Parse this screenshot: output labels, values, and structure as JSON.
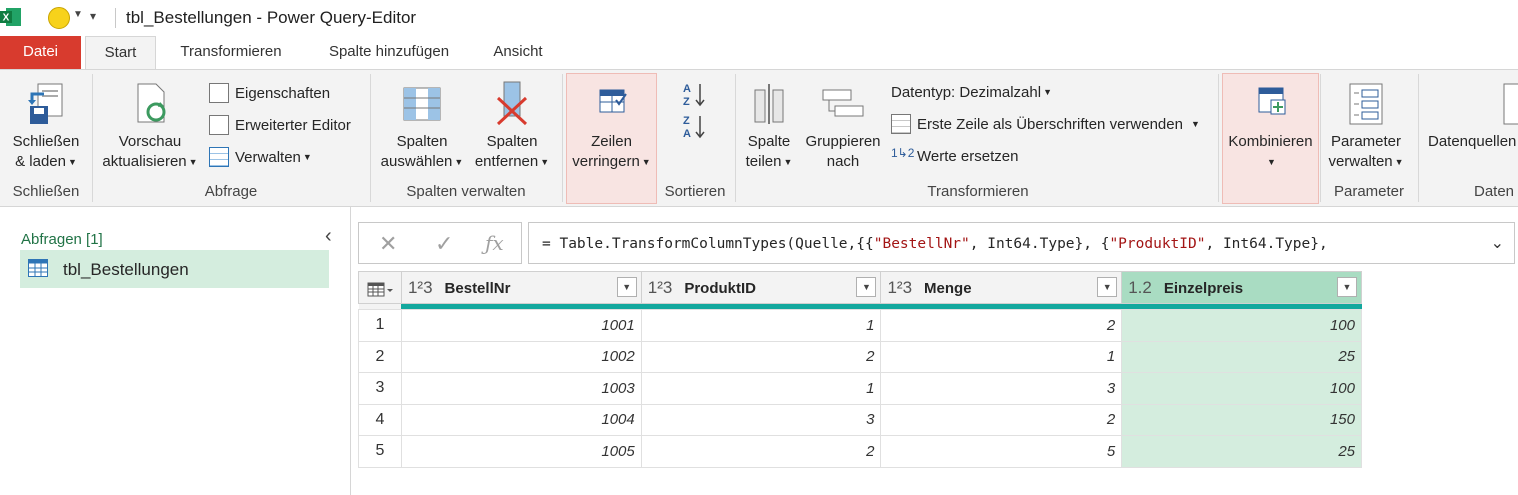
{
  "window": {
    "title": "tbl_Bestellungen - Power Query-Editor",
    "app_icon": "excel-icon"
  },
  "tabs": [
    "Datei",
    "Start",
    "Transformieren",
    "Spalte hinzufügen",
    "Ansicht"
  ],
  "ribbon": {
    "schliessen_laden": [
      "Schließen",
      "& laden"
    ],
    "group_schliessen": "Schließen",
    "vorschau": [
      "Vorschau",
      "aktualisieren"
    ],
    "eigenschaften": "Eigenschaften",
    "erweiterter_editor": "Erweiterter Editor",
    "verwalten": "Verwalten",
    "group_abfrage": "Abfrage",
    "spalten_auswaehlen": [
      "Spalten",
      "auswählen"
    ],
    "spalten_entfernen": [
      "Spalten",
      "entfernen"
    ],
    "group_spalten_verwalten": "Spalten verwalten",
    "zeilen_verringern": [
      "Zeilen",
      "verringern"
    ],
    "group_sortieren": "Sortieren",
    "spalte_teilen": [
      "Spalte",
      "teilen"
    ],
    "gruppieren_nach": [
      "Gruppieren",
      "nach"
    ],
    "datentyp": "Datentyp: Dezimalzahl",
    "erste_zeile": "Erste Zeile als Überschriften verwenden",
    "werte_ersetzen": "Werte ersetzen",
    "group_transformieren": "Transformieren",
    "kombinieren": "Kombinieren",
    "parameter_verwalten": [
      "Parameter",
      "verwalten"
    ],
    "group_parameter": "Parameter",
    "datenquellen": "Datenquellen",
    "group_daten": "Daten"
  },
  "queries_pane": {
    "header": "Abfragen [1]",
    "items": [
      "tbl_Bestellungen"
    ]
  },
  "formula_bar": {
    "prefix": "= Table.TransformColumnTypes(Quelle,{{",
    "s1": "\"BestellNr\"",
    "mid1": ", Int64.Type}, {",
    "s2": "\"ProduktID\"",
    "mid2": ", Int64.Type},"
  },
  "grid": {
    "columns": [
      {
        "type": "1²3",
        "name": "BestellNr"
      },
      {
        "type": "1²3",
        "name": "ProduktID"
      },
      {
        "type": "1²3",
        "name": "Menge"
      },
      {
        "type": "1.2",
        "name": "Einzelpreis"
      }
    ],
    "rows": [
      {
        "n": "1",
        "cells": [
          "1001",
          "1",
          "2",
          "100"
        ]
      },
      {
        "n": "2",
        "cells": [
          "1002",
          "2",
          "1",
          "25"
        ]
      },
      {
        "n": "3",
        "cells": [
          "1003",
          "1",
          "3",
          "100"
        ]
      },
      {
        "n": "4",
        "cells": [
          "1004",
          "3",
          "2",
          "150"
        ]
      },
      {
        "n": "5",
        "cells": [
          "1005",
          "2",
          "5",
          "25"
        ]
      }
    ]
  }
}
